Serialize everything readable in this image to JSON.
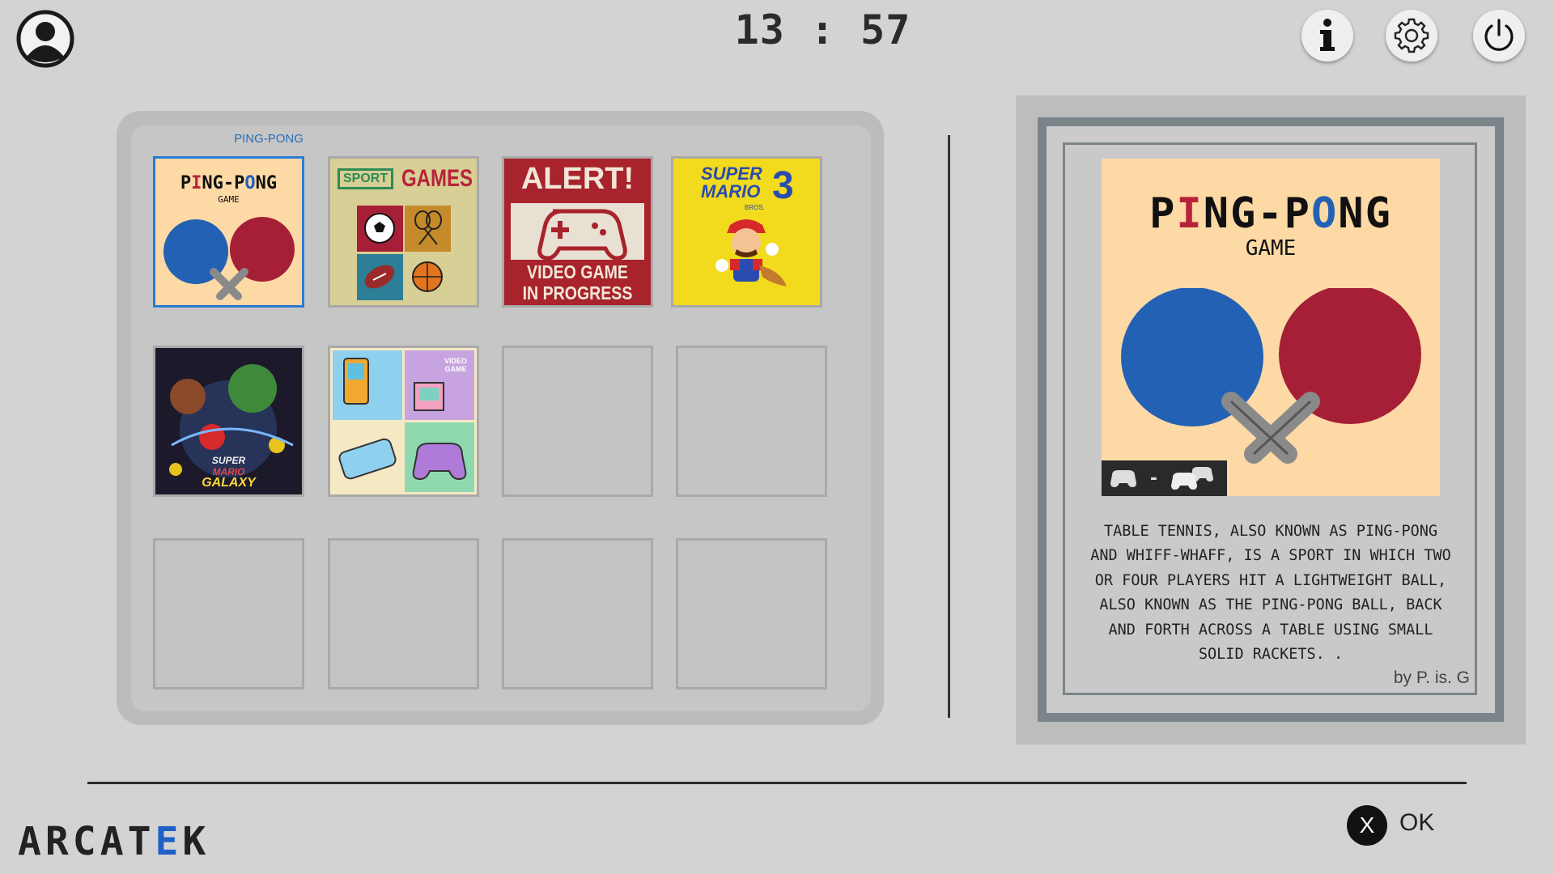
{
  "header": {
    "clock": "13 : 57",
    "icons": [
      "user-icon",
      "info-icon",
      "gear-icon",
      "power-icon"
    ]
  },
  "library": {
    "selected_title": "PING-PONG",
    "tiles": [
      {
        "name": "ping-pong",
        "cover_title": "PING-PONG",
        "cover_sub": "GAME"
      },
      {
        "name": "sport-games",
        "cover_tag": "SPORT",
        "cover_title": "GAMES"
      },
      {
        "name": "alert-video-game",
        "cover_title": "ALERT!",
        "cover_line1": "VIDEO GAME",
        "cover_line2": "IN PROGRESS"
      },
      {
        "name": "super-mario-bros-3",
        "cover_title": "SUPER MARIO",
        "cover_num": "3",
        "cover_sub": "BROS."
      },
      {
        "name": "super-mario-galaxy",
        "cover_line1": "SUPER",
        "cover_line2": "MARIO",
        "cover_line3": "GALAXY"
      },
      {
        "name": "video-game-collage",
        "cover_label": "VIDEO GAME"
      }
    ],
    "empty_slots": 6
  },
  "detail": {
    "cover_title": "PING-PONG",
    "cover_sub": "GAME",
    "cover_players": "-",
    "description": "Table tennis, also known as ping-pong and whiff-whaff, is a sport in which two or four players hit a lightweight ball, also known as the ping-pong ball, back and forth across a table using small solid rackets. .",
    "byline": "by P. is. G"
  },
  "footer": {
    "brand_a": "ARCAT",
    "brand_b": "E",
    "brand_c": "K",
    "button_key": "X",
    "button_label": "OK"
  },
  "colors": {
    "background": "#d3d3d3",
    "selection": "#2a7bd4",
    "paddle_blue": "#2361b5",
    "paddle_red": "#a51f36",
    "brand_accent": "#1f60c6"
  }
}
